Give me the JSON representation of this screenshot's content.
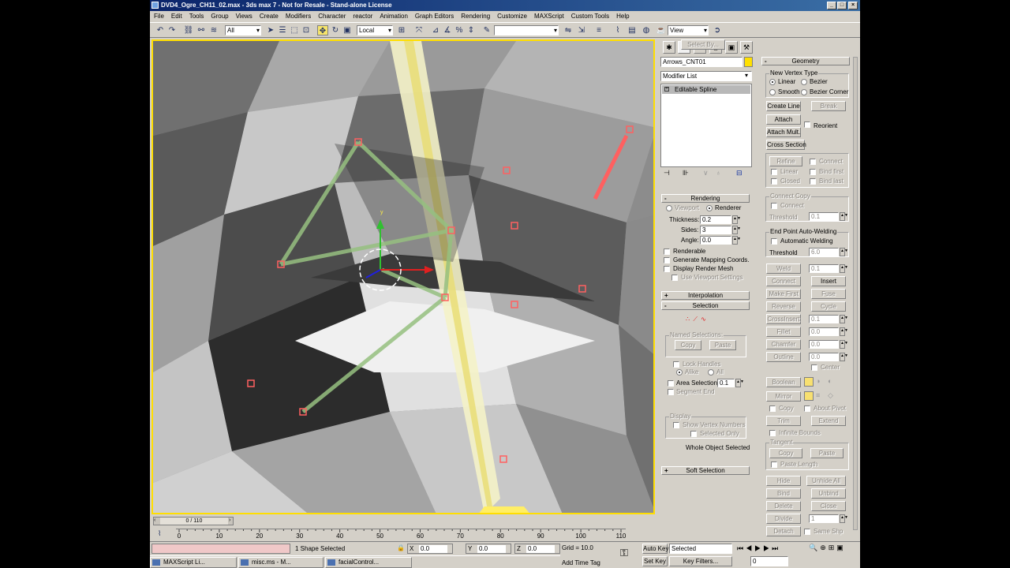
{
  "window": {
    "title": "DVD4_Ogre_CH11_02.max - 3ds max 7 - Not for Resale - Stand-alone License"
  },
  "menu": [
    "File",
    "Edit",
    "Tools",
    "Group",
    "Views",
    "Create",
    "Modifiers",
    "Character",
    "reactor",
    "Animation",
    "Graph Editors",
    "Rendering",
    "Customize",
    "MAXScript",
    "Custom Tools",
    "Help"
  ],
  "toolbar": {
    "selection_filter": "All",
    "coord_system": "Local",
    "named_selection": "",
    "view": "View"
  },
  "command_panel": {
    "object_name": "Arrows_CNT01",
    "object_color": "#ffe000",
    "modifier_list": "Modifier List",
    "stack_item": "Editable Spline",
    "rendering": {
      "title": "Rendering",
      "viewport": "Viewport",
      "renderer": "Renderer",
      "thickness_label": "Thickness:",
      "thickness": "0.2",
      "sides_label": "Sides:",
      "sides": "3",
      "angle_label": "Angle:",
      "angle": "0.0",
      "renderable": "Renderable",
      "gen_mapping": "Generate Mapping Coords.",
      "display_render_mesh": "Display Render Mesh",
      "use_viewport": "Use Viewport Settings"
    },
    "interpolation": {
      "title": "Interpolation"
    },
    "selection": {
      "title": "Selection",
      "named_sel": "Named Selections:",
      "copy": "Copy",
      "paste": "Paste",
      "lock_handles": "Lock Handles",
      "alike": "Alike",
      "all": "All",
      "area_selection": "Area Selection:",
      "area_value": "0.1",
      "segment_end": "Segment End",
      "select_by": "Select By...",
      "display": "Display",
      "show_vertex_numbers": "Show Vertex Numbers",
      "selected_only": "Selected Only",
      "status": "Whole Object Selected"
    },
    "soft_selection": {
      "title": "Soft Selection"
    },
    "geometry": {
      "title": "Geometry",
      "new_vertex_type": "New Vertex Type",
      "linear": "Linear",
      "bezier": "Bezier",
      "smooth": "Smooth",
      "bezier_corner": "Bezier Corner",
      "create_line": "Create Line",
      "break": "Break",
      "attach": "Attach",
      "reorient": "Reorient",
      "attach_mult": "Attach Mult.",
      "cross_section": "Cross Section",
      "refine": "Refine",
      "connect": "Connect",
      "linear2": "Linear",
      "bind_first": "Bind first",
      "closed": "Closed",
      "bind_last": "Bind last",
      "connect_copy": "Connect Copy",
      "connect2": "Connect",
      "threshold": "Threshold",
      "threshold_val": "0.1",
      "end_point_auto": "End Point Auto-Welding",
      "automatic_welding": "Automatic Welding",
      "threshold2": "Threshold",
      "threshold2_val": "6.0",
      "weld": "Weld",
      "weld_val": "0.1",
      "connect3": "Connect",
      "insert": "Insert",
      "make_first": "Make First",
      "fuse": "Fuse",
      "reverse": "Reverse",
      "cycle": "Cycle",
      "crossinsert": "CrossInsert",
      "crossinsert_val": "0.1",
      "fillet": "Fillet",
      "fillet_val": "0.0",
      "chamfer": "Chamfer",
      "chamfer_val": "0.0",
      "outline": "Outline",
      "outline_val": "0.0",
      "center": "Center",
      "boolean": "Boolean",
      "mirror": "Mirror",
      "copy": "Copy",
      "about_pivot": "About Pivot",
      "trim": "Trim",
      "extend": "Extend",
      "infinite_bounds": "Infinite Bounds",
      "tangent": "Tangent",
      "tcopy": "Copy",
      "tpaste": "Paste",
      "paste_length": "Paste Length",
      "hide": "Hide",
      "unhide_all": "Unhide All",
      "bind": "Bind",
      "unbind": "Unbind",
      "delete": "Delete",
      "close": "Close",
      "divide": "Divide",
      "divide_val": "1",
      "detach": "Detach",
      "same_shp": "Same Shp"
    }
  },
  "timeline": {
    "frame": "0 / 110",
    "ticks": [
      "0",
      "10",
      "20",
      "30",
      "40",
      "50",
      "60",
      "70",
      "80",
      "90",
      "100",
      "110"
    ]
  },
  "status": {
    "selected": "1 Shape Selected",
    "x": "0.0",
    "y": "0.0",
    "z": "0.0",
    "grid": "Grid = 10.0",
    "add_time_tag": "Add Time Tag",
    "auto_key": "Auto Key",
    "set_key": "Set Key",
    "key_mode": "Selected",
    "key_filters": "Key Filters...",
    "current_frame": "0"
  },
  "taskbar": [
    "MAXScript Li...",
    "misc.ms - M...",
    "facialControl..."
  ]
}
